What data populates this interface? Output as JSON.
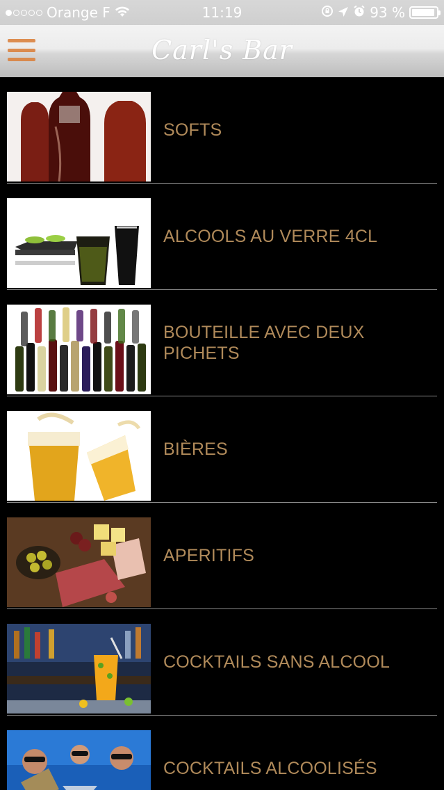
{
  "status_bar": {
    "carrier": "Orange F",
    "time": "11:19",
    "battery": "93 %",
    "battery_fraction": 0.93,
    "signal_bars_filled": 1,
    "signal_bars_total": 5
  },
  "nav": {
    "title": "Carl's Bar",
    "menu_icon": "hamburger-icon"
  },
  "categories": [
    {
      "label": "SOFTS",
      "image": "soft-drink-bottles"
    },
    {
      "label": "ALCOOLS AU VERRE 4CL",
      "image": "shot-glasses-lime"
    },
    {
      "label": "BOUTEILLE AVEC DEUX PICHETS",
      "image": "wine-bottles"
    },
    {
      "label": "BIÈRES",
      "image": "beer-glasses"
    },
    {
      "label": "APERITIFS",
      "image": "charcuterie-olives"
    },
    {
      "label": "COCKTAILS SANS ALCOOL",
      "image": "mocktail-bar"
    },
    {
      "label": "COCKTAILS ALCOOLISÉS",
      "image": "cocktail-party"
    }
  ],
  "colors": {
    "label_text": "#b08a5a",
    "background": "#000000",
    "menu_icon": "#d9823f"
  }
}
